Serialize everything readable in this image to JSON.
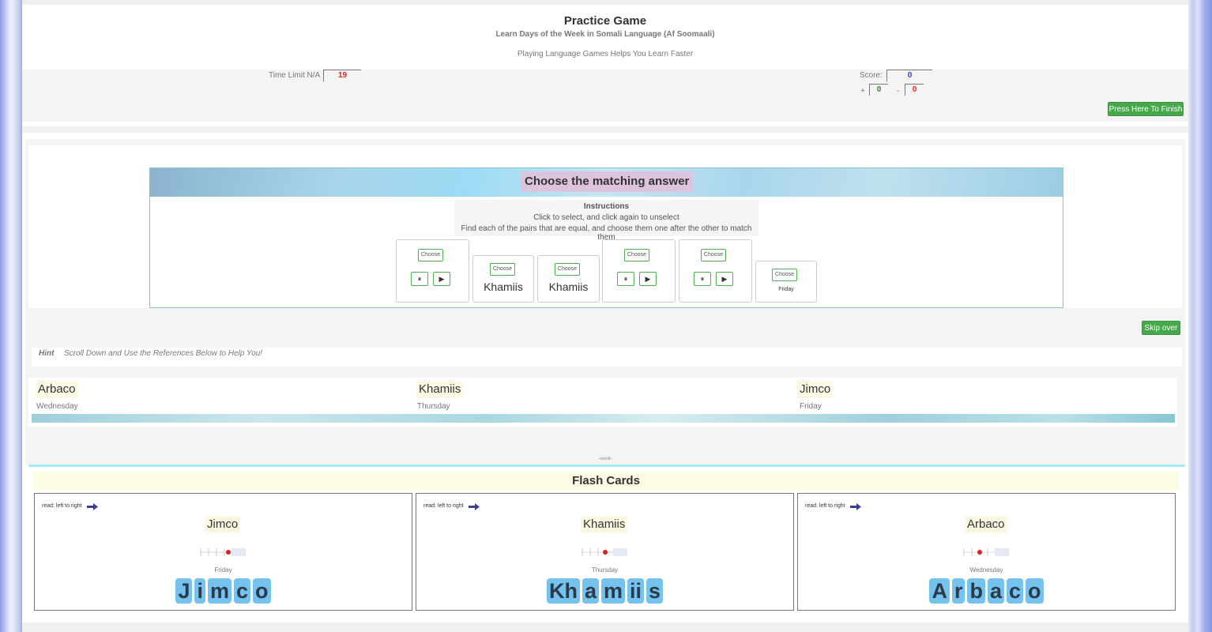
{
  "header": {
    "title": "Practice Game",
    "subtitle": "Learn Days of the Week in Somali Language (Af Soomaali)",
    "tagline": "Playing Language Games Helps You Learn Faster",
    "time_limit_label": "Time Limit N/A",
    "time_value": "19",
    "score_label": "Score:",
    "score_value": "0",
    "plus_sign": "+",
    "plus_value": "0",
    "minus_sign": "-",
    "minus_value": "0",
    "finish_button": "Press Here To Finish",
    "colors": {
      "finish_button": "#45a84a",
      "time": "#e0271b",
      "score": "#2a3fb8",
      "plus": "#2d8b2d",
      "minus": "#e0271b"
    }
  },
  "game": {
    "question": "Choose the matching answer",
    "instructions_title": "Instructions",
    "instruction_1": "Click to select, and click again to unselect",
    "instruction_2": "Find each of the pairs that are equal, and choose them one after the other to match them",
    "choose_label": "Choose",
    "pause_icon": "⏸",
    "play_icon": "▶",
    "options": [
      {
        "type": "audio"
      },
      {
        "type": "word",
        "text": "Khamiis"
      },
      {
        "type": "word",
        "text": "Khamiis"
      },
      {
        "type": "audio"
      },
      {
        "type": "audio"
      },
      {
        "type": "small",
        "text": "Friday"
      }
    ],
    "skip_button": "Skip over"
  },
  "hint": {
    "label": "Hint",
    "text": "Scroll Down and Use the References Below to Help You!"
  },
  "references": [
    {
      "word": "Arbaco",
      "translation": "Wednesday"
    },
    {
      "word": "Khamiis",
      "translation": "Thursday"
    },
    {
      "word": "Jimco",
      "translation": "Friday"
    }
  ],
  "scroll_tag": "--scroll--",
  "flash_cards": {
    "title": "Flash Cards",
    "read_label": "read: left to right",
    "cards": [
      {
        "word": "Jimco",
        "translation": "Friday",
        "letters": [
          "J",
          "i",
          "m",
          "c",
          "o"
        ]
      },
      {
        "word": "Khamiis",
        "translation": "Thursday",
        "letters": [
          "Kh",
          "a",
          "m",
          "ii",
          "s"
        ]
      },
      {
        "word": "Arbaco",
        "translation": "Wednesday",
        "letters": [
          "A",
          "r",
          "b",
          "a",
          "c",
          "o"
        ]
      }
    ]
  }
}
